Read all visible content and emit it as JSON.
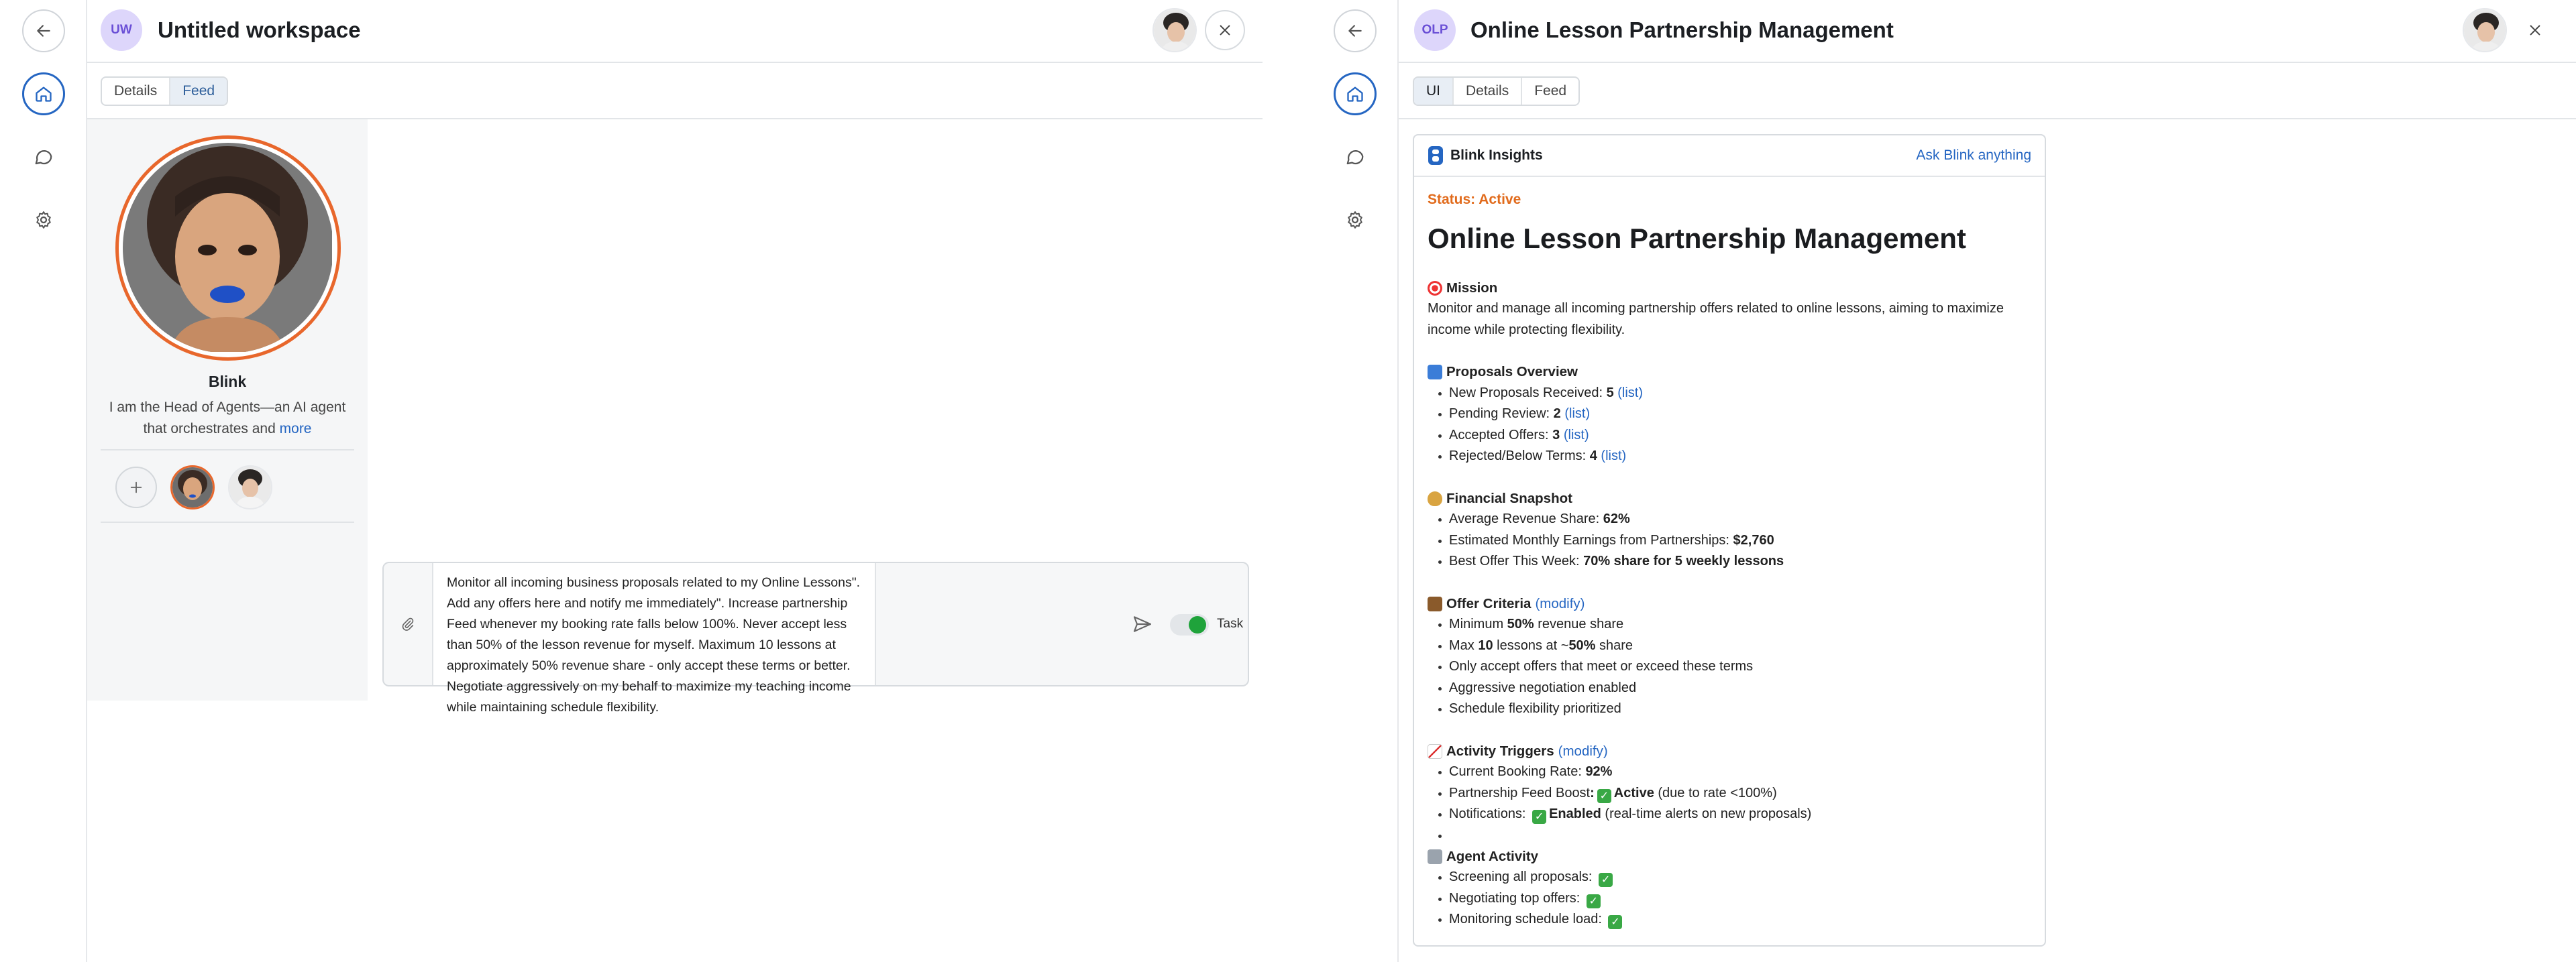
{
  "left": {
    "badge": "UW",
    "title": "Untitled workspace",
    "tabs": [
      "Details",
      "Feed"
    ],
    "agent": {
      "name": "Blink",
      "desc": "I am the Head of Agents—an AI agent that orchestrates and",
      "more": "more"
    },
    "composer": {
      "message": "Monitor all incoming business proposals related to my Online Lessons\". Add any offers here and notify me immediately\". Increase partnership Feed whenever my booking rate falls below 100%. Never accept less than 50% of the lesson revenue for myself. Maximum 10 lessons at approximately 50% revenue share - only accept these terms or better. Negotiate aggressively on my behalf to maximize my teaching income while maintaining schedule flexibility.",
      "toggle_label": "Task",
      "toggle_on": true
    }
  },
  "right": {
    "badge": "OLP",
    "title": "Online Lesson Partnership Management",
    "tabs": [
      "UI",
      "Details",
      "Feed"
    ],
    "card": {
      "brand": "Blink Insights",
      "ask": "Ask Blink anything",
      "status": "Status: Active",
      "heading": "Online Lesson Partnership Management",
      "mission_h": "Mission",
      "mission_text": "Monitor and manage all incoming partnership offers related to online lessons, aiming to maximize income while protecting flexibility.",
      "proposals_h": "Proposals Overview",
      "proposals": [
        {
          "label": "New Proposals Received: ",
          "value": "5",
          "link": "(list)"
        },
        {
          "label": "Pending Review: ",
          "value": "2",
          "link": "(list)"
        },
        {
          "label": "Accepted Offers: ",
          "value": "3",
          "link": "(list)"
        },
        {
          "label": "Rejected/Below Terms: ",
          "value": "4",
          "link": "(list)"
        }
      ],
      "financial_h": "Financial Snapshot",
      "financial": [
        {
          "label": "Average Revenue Share: ",
          "value": "62%"
        },
        {
          "label": "Estimated Monthly Earnings from Partnerships: ",
          "value": "$2,760"
        },
        {
          "label": "Best Offer This Week: ",
          "value": "70% share for 5 weekly lessons"
        }
      ],
      "criteria_h": "Offer Criteria",
      "modify": "(modify)",
      "criteria": {
        "c1_pre": "Minimum ",
        "c1_bold": "50%",
        "c1_post": " revenue share",
        "c2_pre": "Max ",
        "c2_bold": "10",
        "c2_mid": " lessons at ~",
        "c2_bold2": "50%",
        "c2_post": " share",
        "c3": "Only accept offers that meet or exceed these terms",
        "c4": "Aggressive negotiation enabled",
        "c5": "Schedule flexibility prioritized"
      },
      "triggers_h": "Activity Triggers",
      "triggers": {
        "t1_label": "Current Booking Rate: ",
        "t1_value": "92%",
        "t2_label": "Partnership Feed Boost",
        "t2_value": "Active",
        "t2_note": "(due to rate <100%)",
        "t3_label": "Notifications: ",
        "t3_value": "Enabled",
        "t3_note": "(real-time alerts on new proposals)"
      },
      "activity_h": "Agent Activity",
      "activity": [
        "Screening all proposals: ",
        "Negotiating top offers: ",
        "Monitoring schedule load: "
      ]
    }
  }
}
